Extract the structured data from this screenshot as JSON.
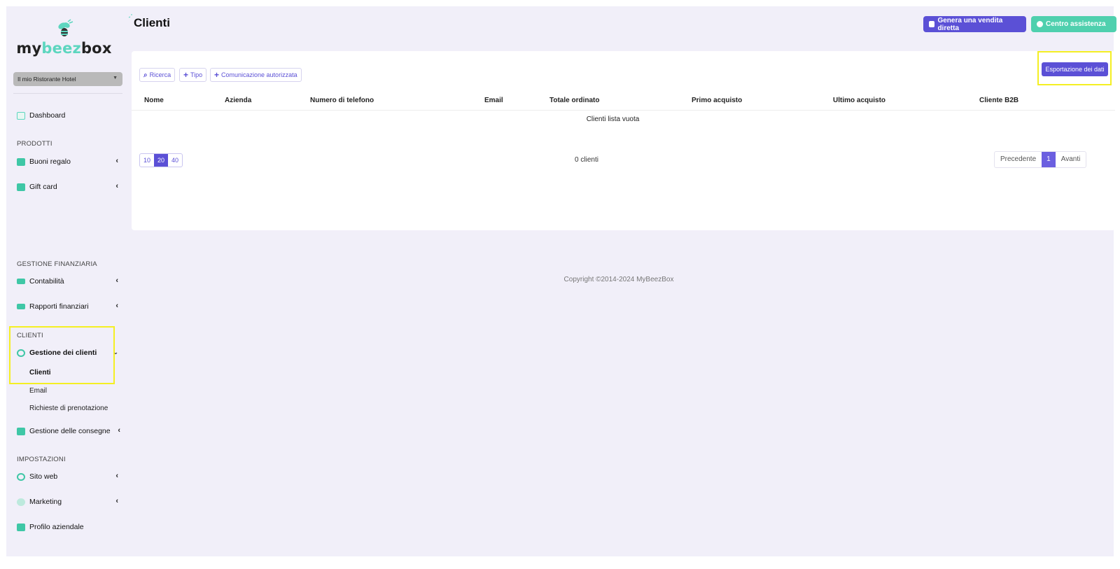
{
  "brand": {
    "logo_prefix": "my",
    "logo_mid": "beez",
    "logo_suffix": "box",
    "accent": "#5dd6bf",
    "primary": "#5b50d6"
  },
  "sidebar": {
    "venue_selector": "Il mio Ristorante Hotel",
    "dashboard": "Dashboard",
    "sections": {
      "products": "PRODOTTI",
      "finance": "GESTIONE FINANZIARIA",
      "clients": "CLIENTI",
      "settings": "IMPOSTAZIONI"
    },
    "items": {
      "gift_vouchers": "Buoni regalo",
      "gift_card": "Gift card",
      "accounting": "Contabilità",
      "financial_reports": "Rapporti finanziari",
      "client_management": "Gestione dei clienti",
      "clients_sub": "Clienti",
      "email_sub": "Email",
      "booking_requests_sub": "Richieste di prenotazione",
      "deliveries": "Gestione delle consegne",
      "website": "Sito web",
      "marketing": "Marketing",
      "company_profile": "Profilo aziendale"
    }
  },
  "header": {
    "title": "Clienti",
    "generate_sale": "Genera una vendita diretta",
    "help_center": "Centro assistenza"
  },
  "toolbar": {
    "search": "Ricerca",
    "type": "Tipo",
    "authorized_comm": "Comunicazione autorizzata",
    "export": "Esportazione dei dati"
  },
  "table": {
    "columns": [
      "Nome",
      "Azienda",
      "Numero di telefono",
      "Email",
      "Totale ordinato",
      "Primo acquisto",
      "Ultimo acquisto",
      "Cliente B2B"
    ],
    "empty_message": "Clienti lista vuota"
  },
  "pagination": {
    "page_sizes": [
      "10",
      "20",
      "40"
    ],
    "selected_size": "20",
    "count": "0 clienti",
    "prev": "Precedente",
    "current": "1",
    "next": "Avanti"
  },
  "footer": {
    "copyright": "Copyright ©2014-2024 MyBeezBox"
  }
}
